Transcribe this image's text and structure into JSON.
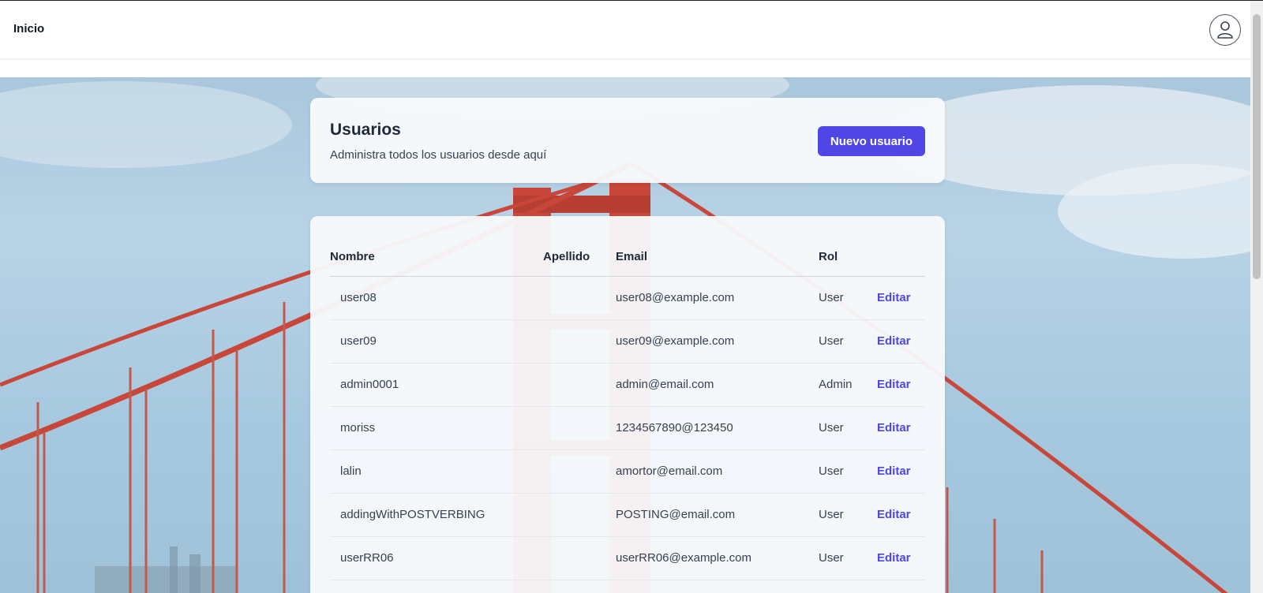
{
  "navbar": {
    "home_label": "Inicio",
    "profile_icon": "user-icon"
  },
  "header": {
    "title": "Usuarios",
    "subtitle": "Administra todos los usuarios desde aquí",
    "new_user_label": "Nuevo usuario"
  },
  "table": {
    "columns": {
      "name": "Nombre",
      "lastname": "Apellido",
      "email": "Email",
      "role": "Rol"
    },
    "rows": [
      {
        "name": "user08",
        "lastname": "",
        "email": "user08@example.com",
        "role": "User",
        "action": "Editar"
      },
      {
        "name": "user09",
        "lastname": "",
        "email": "user09@example.com",
        "role": "User",
        "action": "Editar"
      },
      {
        "name": "admin0001",
        "lastname": "",
        "email": "admin@email.com",
        "role": "Admin",
        "action": "Editar"
      },
      {
        "name": "moriss",
        "lastname": "",
        "email": "1234567890@123450",
        "role": "User",
        "action": "Editar"
      },
      {
        "name": "lalin",
        "lastname": "",
        "email": "amortor@email.com",
        "role": "User",
        "action": "Editar"
      },
      {
        "name": "addingWithPOSTVERBING",
        "lastname": "",
        "email": "POSTING@email.com",
        "role": "User",
        "action": "Editar"
      },
      {
        "name": "userRR06",
        "lastname": "",
        "email": "userRR06@example.com",
        "role": "User",
        "action": "Editar"
      }
    ]
  },
  "colors": {
    "accent": "#4f46e5",
    "bridge": "#c8473a"
  }
}
